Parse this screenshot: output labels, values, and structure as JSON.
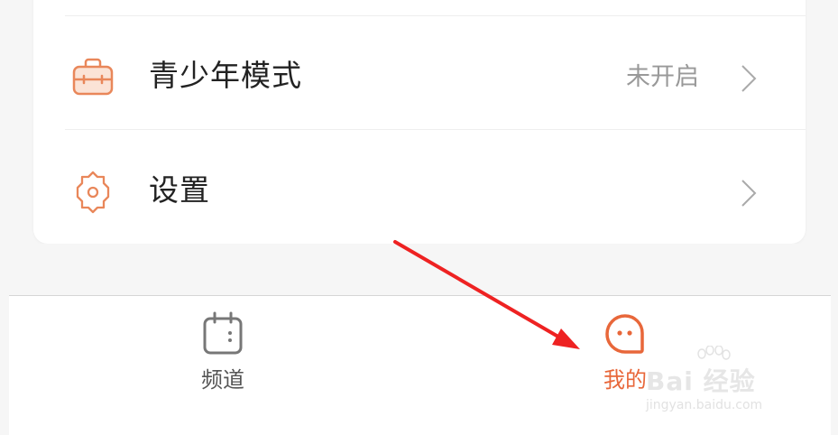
{
  "settings_card": {
    "items": [
      {
        "label": "青少年模式",
        "status": "未开启",
        "icon": "teen-mode-briefcase-icon",
        "chevron": "chevron-right-icon"
      },
      {
        "label": "设置",
        "icon": "settings-gear-icon",
        "chevron": "chevron-right-icon"
      }
    ]
  },
  "tabbar": {
    "tabs": [
      {
        "label": "频道",
        "icon": "calendar-channel-icon",
        "active": false
      },
      {
        "label": "我的",
        "icon": "ghost-mine-icon",
        "active": true
      }
    ]
  },
  "watermark": {
    "brand": "Bai 经验",
    "domain": "jingyan.baidu.com"
  },
  "colors": {
    "accent": "#e8673a",
    "icon_orange": "#e9875a",
    "annotation_arrow": "#ee2222",
    "text_primary": "#222222",
    "text_secondary": "#999999"
  }
}
